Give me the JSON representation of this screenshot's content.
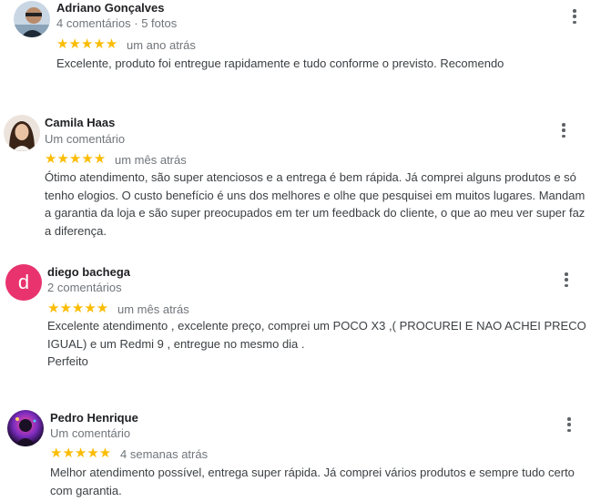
{
  "reviews": [
    {
      "name": "Adriano Gonçalves",
      "meta": "4 comentários · 5 fotos",
      "stars": "★★★★★",
      "date": "um ano atrás",
      "text": "Excelente, produto foi entregue rapidamente e tudo conforme o previsto. Recomendo"
    },
    {
      "name": "Camila Haas",
      "meta": "Um comentário",
      "stars": "★★★★★",
      "date": "um mês atrás",
      "text": "Ótimo atendimento, são super atenciosos e a entrega é bem rápida. Já comprei alguns produtos e só tenho elogios. O custo benefício é uns dos melhores e olhe que pesquisei em muitos lugares. Mandam a garantia da loja e são super preocupados em ter um feedback do cliente, o que ao meu ver super faz a diferença."
    },
    {
      "name": "diego bachega",
      "meta": "2 comentários",
      "avatar_letter": "d",
      "stars": "★★★★★",
      "date": "um mês atrás",
      "text": "Excelente atendimento , excelente preço, comprei um POCO X3 ,( PROCUREI E NAO ACHEI PRECO IGUAL) e um Redmi 9 , entregue no mesmo dia .\nPerfeito"
    },
    {
      "name": "Pedro Henrique",
      "meta": "Um comentário",
      "stars": "★★★★★",
      "date": "4 semanas atrás",
      "text": "Melhor atendimento possível, entrega super rápida. Já comprei vários produtos e sempre tudo certo com garantia."
    }
  ],
  "ratings": [
    5,
    5,
    5,
    5
  ],
  "colors": {
    "star": "#fbbc04",
    "avatar_d": "#e8336f",
    "meta": "#70757a"
  },
  "icons": {
    "menu": "more-vert-icon"
  }
}
